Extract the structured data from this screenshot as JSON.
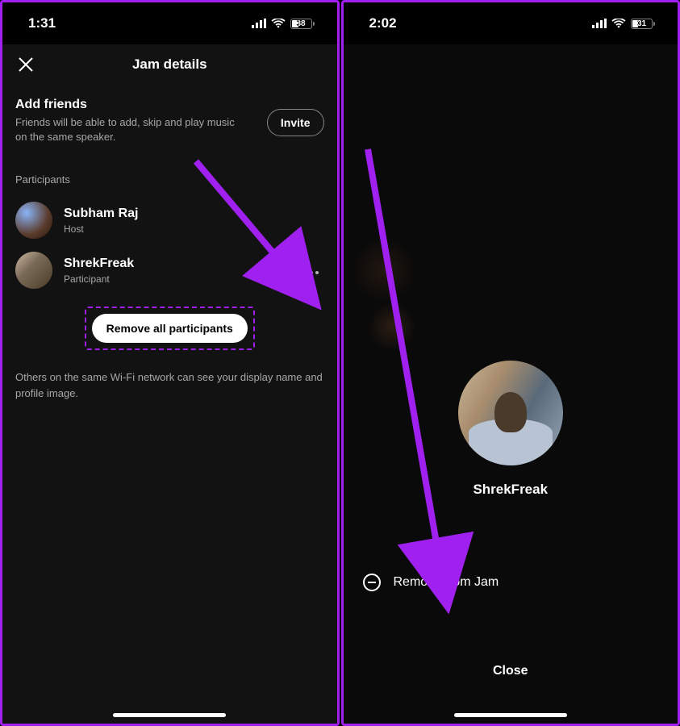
{
  "left": {
    "status": {
      "time": "1:31",
      "battery_pct": "38",
      "battery_fill": "38%"
    },
    "header": {
      "title": "Jam details"
    },
    "add_friends": {
      "heading": "Add friends",
      "description": "Friends will be able to add, skip and play music on the same speaker.",
      "invite_label": "Invite"
    },
    "participants_label": "Participants",
    "participants": [
      {
        "name": "Subham Raj",
        "role": "Host"
      },
      {
        "name": "ShrekFreak",
        "role": "Participant"
      }
    ],
    "remove_all_label": "Remove all participants",
    "wifi_note": "Others on the same Wi-Fi network can see your display name and profile image."
  },
  "right": {
    "status": {
      "time": "2:02",
      "battery_pct": "31",
      "battery_fill": "31%"
    },
    "participant_name": "ShrekFreak",
    "remove_label": "Remove from Jam",
    "close_label": "Close"
  }
}
